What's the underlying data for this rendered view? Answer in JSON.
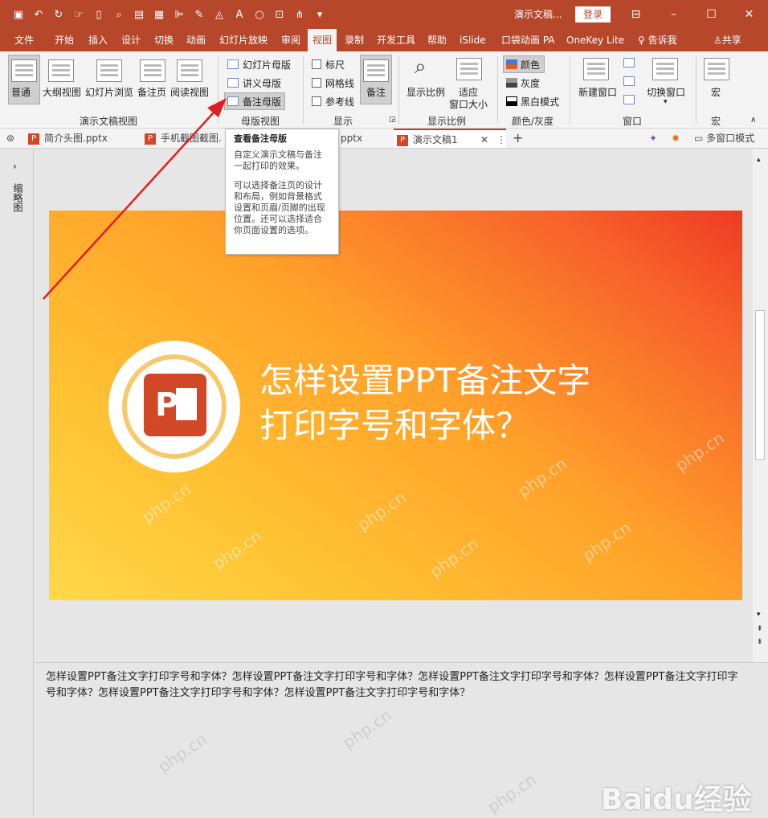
{
  "titlebar": {
    "doc_title": "演示文稿...",
    "login": "登录",
    "qat_icons": [
      "save-icon",
      "undo-icon",
      "redo-icon",
      "touch-icon",
      "new-icon",
      "print-preview-icon",
      "open-icon",
      "table-icon",
      "align-icon",
      "brush-icon",
      "font-color-icon",
      "font-icon",
      "shape-icon",
      "select-icon",
      "tools-icon",
      "customize-icon"
    ],
    "window_buttons": [
      "ribbon-display-icon",
      "minimize-icon",
      "maximize-icon",
      "close-icon"
    ]
  },
  "menu": {
    "tabs": [
      "文件",
      "开始",
      "插入",
      "设计",
      "切换",
      "动画",
      "幻灯片放映",
      "审阅",
      "视图",
      "录制",
      "开发工具",
      "帮助",
      "iSlide",
      "口袋动画 PA",
      "OneKey Lite",
      "告诉我",
      "共享"
    ],
    "active": "视图"
  },
  "ribbon": {
    "presentation_views": {
      "group": "演示文稿视图",
      "buttons": [
        "普通",
        "大纲视图",
        "幻灯片浏览",
        "备注页",
        "阅读视图"
      ]
    },
    "master_views": {
      "group": "母版视图",
      "buttons": [
        "幻灯片母版",
        "讲义母版",
        "备注母版"
      ]
    },
    "show": {
      "group": "显示",
      "checkboxes": [
        "标尺",
        "网格线",
        "参考线"
      ],
      "notes": "备注"
    },
    "zoom": {
      "group": "显示比例",
      "buttons": [
        "显示比例",
        "适应",
        "窗口大小"
      ]
    },
    "color": {
      "group": "颜色/灰度",
      "options": [
        "颜色",
        "灰度",
        "黑白模式"
      ]
    },
    "window": {
      "group": "窗口",
      "buttons": [
        "新建窗口",
        "切换窗口"
      ]
    },
    "macro": {
      "group": "宏",
      "button": "宏"
    }
  },
  "file_tabs": [
    "简介头图.pptx",
    "手机截图截图.",
    "pptx",
    "演示文稿1"
  ],
  "file_tabs_right": "多窗口模式",
  "tooltip": {
    "title": "查看备注母版",
    "p1": "自定义演示文稿与备注一起打印的效果。",
    "p2": "可以选择备注页的设计和布局，例如背景格式设置和页眉/页脚的出现位置。还可以选择适合你页面设置的选项。"
  },
  "left_pane_label": "缩略图",
  "slide": {
    "title_line1": "怎样设置PPT备注文字",
    "title_line2": "打印字号和字体？",
    "logo_letter": "P"
  },
  "notes_text": "怎样设置PPT备注文字打印字号和字体？怎样设置PPT备注文字打印字号和字体？怎样设置PPT备注文字打印字号和字体？怎样设置PPT备注文字打印字号和字体？怎样设置PPT备注文字打印字号和字体？怎样设置PPT备注文字打印字号和字体？",
  "watermark": "php.cn",
  "baidu_logo": "Baidu经验",
  "colors": {
    "accent": "#b7472a",
    "ribbon_bg": "#f3f3f3",
    "arrow": "#e02020"
  }
}
